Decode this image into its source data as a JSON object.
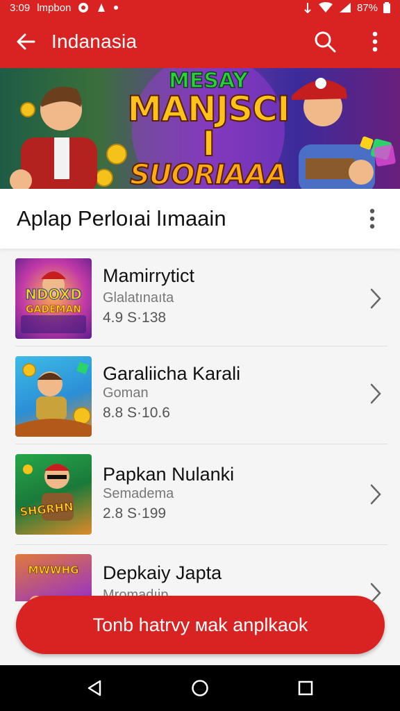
{
  "status_bar": {
    "time": "3:09",
    "carrier": "lmpbon",
    "battery": "87%"
  },
  "app_bar": {
    "title": "Indanasia",
    "back_icon": "arrow-left-icon",
    "search_icon": "search-icon",
    "menu_icon": "more-vert-icon"
  },
  "banner": {
    "line1": "MESAY",
    "line2": "MANJSCI I",
    "line3": "SUORIAAA"
  },
  "section": {
    "title": "Aplap Perloıai lımaain"
  },
  "apps": [
    {
      "name": "Mamirrytict",
      "subtitle": "Glalatınaıta",
      "meta": "4.9 S·138",
      "thumb_text1": "NDOXD",
      "thumb_text2": "GADEMAN"
    },
    {
      "name": "Garaliicha Karali",
      "subtitle": "Goman",
      "meta": "8.8 S·10.6",
      "thumb_text1": "",
      "thumb_text2": ""
    },
    {
      "name": "Papkan Nulanki",
      "subtitle": "Semadema",
      "meta": "2.8 S·199",
      "thumb_text1": "SHGRHN",
      "thumb_text2": ""
    },
    {
      "name": "Depkaiy Japta",
      "subtitle": "Mromadıip",
      "meta": "",
      "thumb_text1": "MWWHG",
      "thumb_text2": ""
    }
  ],
  "cta": {
    "label": "Tonb hatrvy мak anplkaok"
  },
  "colors": {
    "primary": "#d92323",
    "background": "#f5f5f5",
    "nav": "#000000"
  }
}
